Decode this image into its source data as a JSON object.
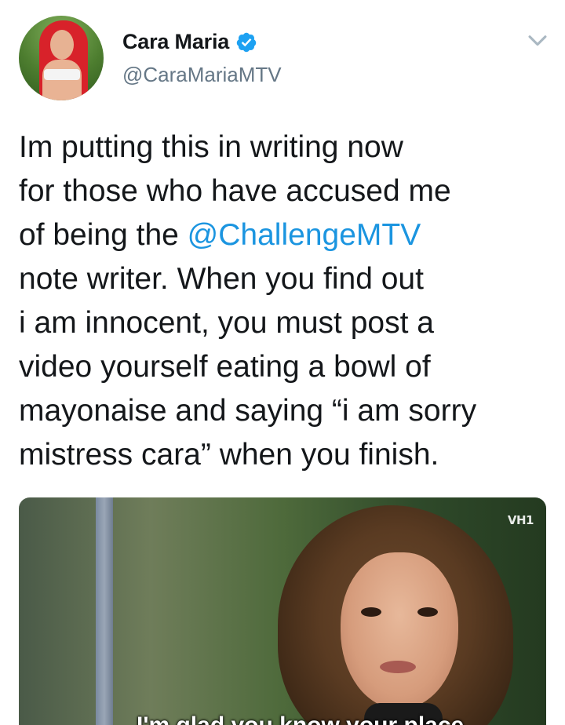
{
  "tweet": {
    "author": {
      "display_name": "Cara Maria",
      "handle": "@CaraMariaMTV",
      "verified": true
    },
    "text_lines": [
      [
        {
          "t": "Im putting this in writing now"
        }
      ],
      [
        {
          "t": "for those who have accused me"
        }
      ],
      [
        {
          "t": "of being the "
        },
        {
          "t": "@ChallengeMTV",
          "mention": true
        }
      ],
      [
        {
          "t": "note writer. When you find out"
        }
      ],
      [
        {
          "t": "i am innocent, you must post a"
        }
      ],
      [
        {
          "t": "video yourself eating a bowl of"
        }
      ],
      [
        {
          "t": "mayonaise and saying  “i am sorry"
        }
      ],
      [
        {
          "t": "mistress cara” when you finish."
        }
      ]
    ],
    "media": {
      "watermark": "VH1",
      "caption": "I'm glad you know your place"
    }
  },
  "colors": {
    "text": "#14171a",
    "secondary": "#657786",
    "mention": "#1b95e0",
    "verified_badge": "#1da1f2"
  },
  "icons": {
    "verified": "verified-badge-icon",
    "menu": "chevron-down-icon"
  }
}
